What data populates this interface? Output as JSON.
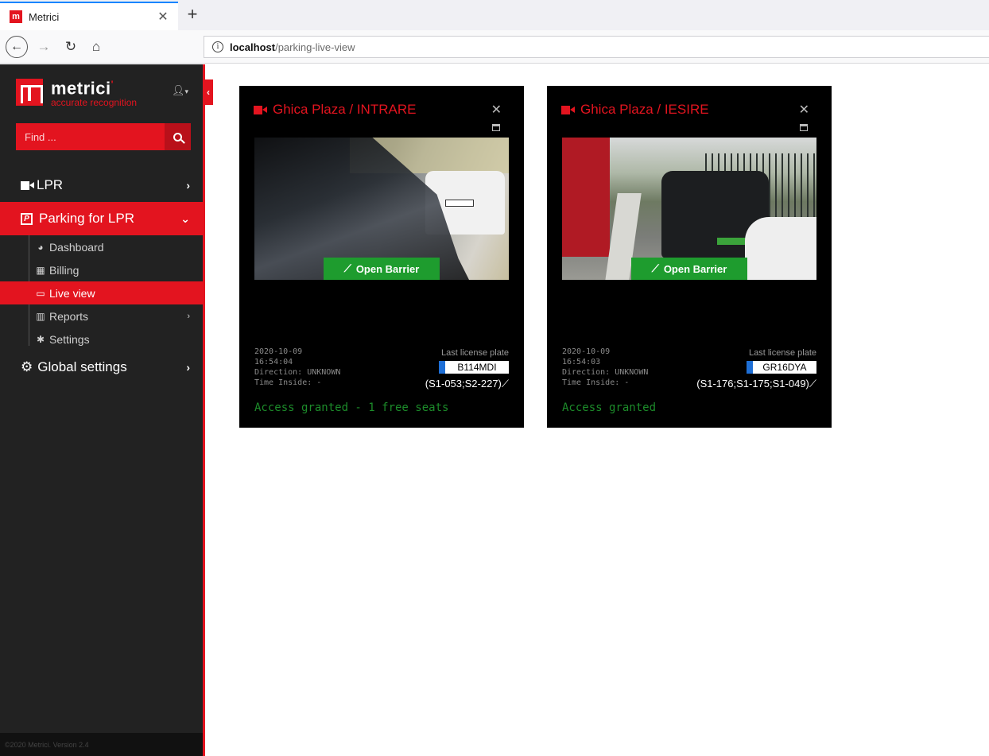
{
  "browser": {
    "tab_title": "Metrici",
    "tab_favicon": "m",
    "url_host": "localhost",
    "url_path": "/parking-live-view"
  },
  "sidebar": {
    "brand_name": "metrici",
    "brand_tagline": "accurate recognition",
    "search_placeholder": "Find ...",
    "menu": {
      "lpr": "LPR",
      "parking": "Parking for LPR",
      "dashboard": "Dashboard",
      "billing": "Billing",
      "live_view": "Live view",
      "reports": "Reports",
      "settings": "Settings",
      "global_settings": "Global settings"
    },
    "footer": "©2020 Metrici. Version 2.4"
  },
  "cameras": [
    {
      "title": "Ghica Plaza / INTRARE",
      "button_label": "Open Barrier",
      "date": "2020-10-09",
      "time": "16:54:04",
      "direction": "Direction: UNKNOWN",
      "time_inside": "Time Inside: -",
      "last_plate_label": "Last license plate",
      "plate": "B114MDI",
      "spots": "(S1-053;S2-227)",
      "status": "Access granted - 1 free seats"
    },
    {
      "title": "Ghica Plaza / IESIRE",
      "button_label": "Open Barrier",
      "date": "2020-10-09",
      "time": "16:54:03",
      "direction": "Direction: UNKNOWN",
      "time_inside": "Time Inside: -",
      "last_plate_label": "Last license plate",
      "plate": "GR16DYA",
      "spots": "(S1-176;S1-175;S1-049)",
      "status": "Access granted"
    }
  ],
  "colors": {
    "brand_red": "#e3141f",
    "sidebar_bg": "#222222",
    "success_green": "#1e9c2e",
    "plate_blue": "#1e6fd6"
  },
  "icons": {
    "camera": "video-camera-icon",
    "parking": "parking-p-icon",
    "dashboard": "palette-icon",
    "billing": "calculator-icon",
    "live_view": "monitor-icon",
    "reports": "bar-chart-icon",
    "settings": "gear-icon",
    "global_settings": "gears-icon",
    "barrier": "barrier-arm-icon"
  }
}
